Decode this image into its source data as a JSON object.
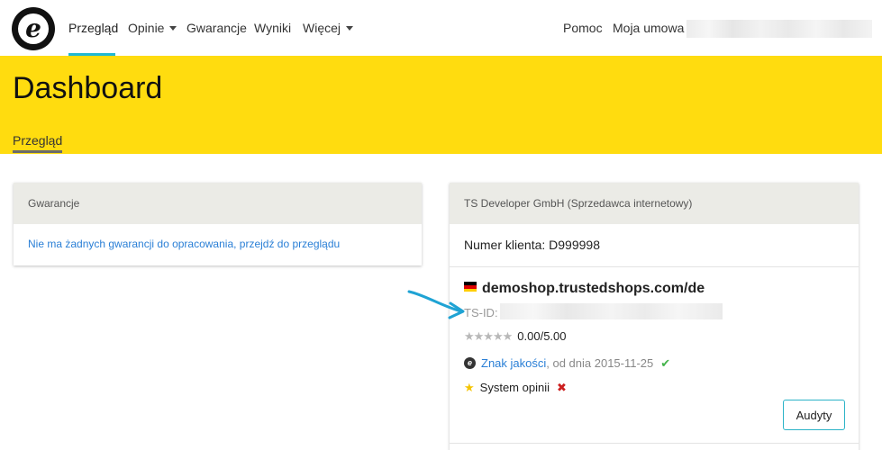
{
  "nav": {
    "items": [
      {
        "label": "Przegląd"
      },
      {
        "label": "Opinie"
      },
      {
        "label": "Gwarancje"
      },
      {
        "label": "Wyniki"
      },
      {
        "label": "Więcej"
      }
    ],
    "help": "Pomoc",
    "contract": "Moja umowa",
    "accent_color": "#1fb8d4"
  },
  "hero": {
    "title": "Dashboard",
    "tab": "Przegląd",
    "background": "#ffdc0f"
  },
  "guarantees_card": {
    "title": "Gwarancje",
    "link": "Nie ma żadnych gwarancji do opracowania, przejdź do przeglądu"
  },
  "seller_card": {
    "title": "TS Developer GmbH (Sprzedawca internetowy)",
    "client_label": "Numer klienta:",
    "client_number": "D999998",
    "shop_domain": "demoshop.trustedshops.com/de",
    "tsid_label": "TS-ID:",
    "stars": "★★★★★",
    "rating": "0.00/5.00",
    "quality_link": "Znak jakości",
    "quality_date": ", od dnia 2015-11-25",
    "quality_status": "✔",
    "review_system": "System opinii",
    "review_status": "✖",
    "audit_button": "Audyty"
  }
}
